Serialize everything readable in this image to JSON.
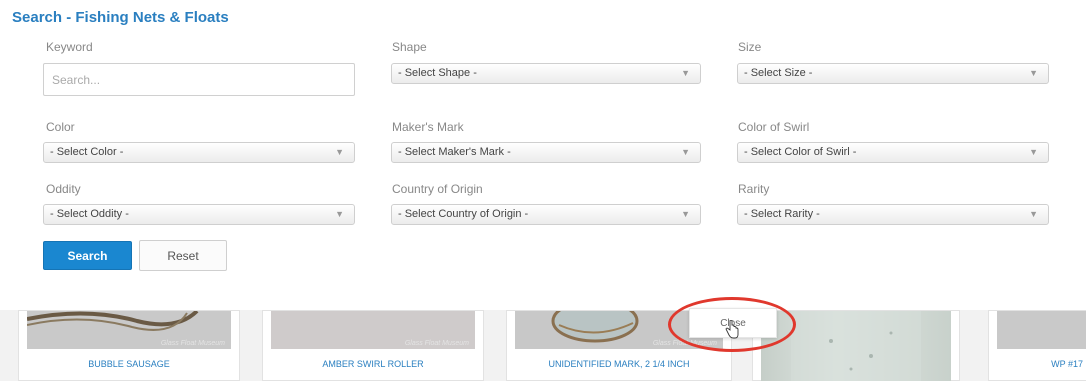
{
  "page_title": "Search - Fishing Nets & Floats",
  "filters": {
    "keyword": {
      "label": "Keyword",
      "placeholder": "Search..."
    },
    "shape": {
      "label": "Shape",
      "value": "- Select Shape -"
    },
    "size": {
      "label": "Size",
      "value": "- Select Size -"
    },
    "color": {
      "label": "Color",
      "value": "- Select Color -"
    },
    "makers_mark": {
      "label": "Maker's Mark",
      "value": "- Select Maker's Mark -"
    },
    "color_of_swirl": {
      "label": "Color of Swirl",
      "value": "- Select Color of Swirl -"
    },
    "oddity": {
      "label": "Oddity",
      "value": "- Select Oddity -"
    },
    "country_of_origin": {
      "label": "Country of Origin",
      "value": "- Select Country of Origin -"
    },
    "rarity": {
      "label": "Rarity",
      "value": "- Select Rarity -"
    }
  },
  "buttons": {
    "search": "Search",
    "reset": "Reset"
  },
  "results": [
    {
      "name": "BUBBLE SAUSAGE",
      "watermark": "Glass Float Museum"
    },
    {
      "name": "AMBER SWIRL ROLLER",
      "watermark": "Glass Float Museum"
    },
    {
      "name": "UNIDENTIFIED MARK, 2 1/4 INCH",
      "watermark": "Glass Float Museum"
    },
    {
      "name": ""
    },
    {
      "name": "WP #17"
    }
  ],
  "popup": {
    "close_label": "Close"
  },
  "colors": {
    "accent": "#2a7fc0",
    "search_button": "#1a87d0",
    "highlight_ring": "#e0382d"
  },
  "icons": {
    "select_chevron": "chevron-down-icon",
    "cursor": "hand-pointer-icon"
  }
}
